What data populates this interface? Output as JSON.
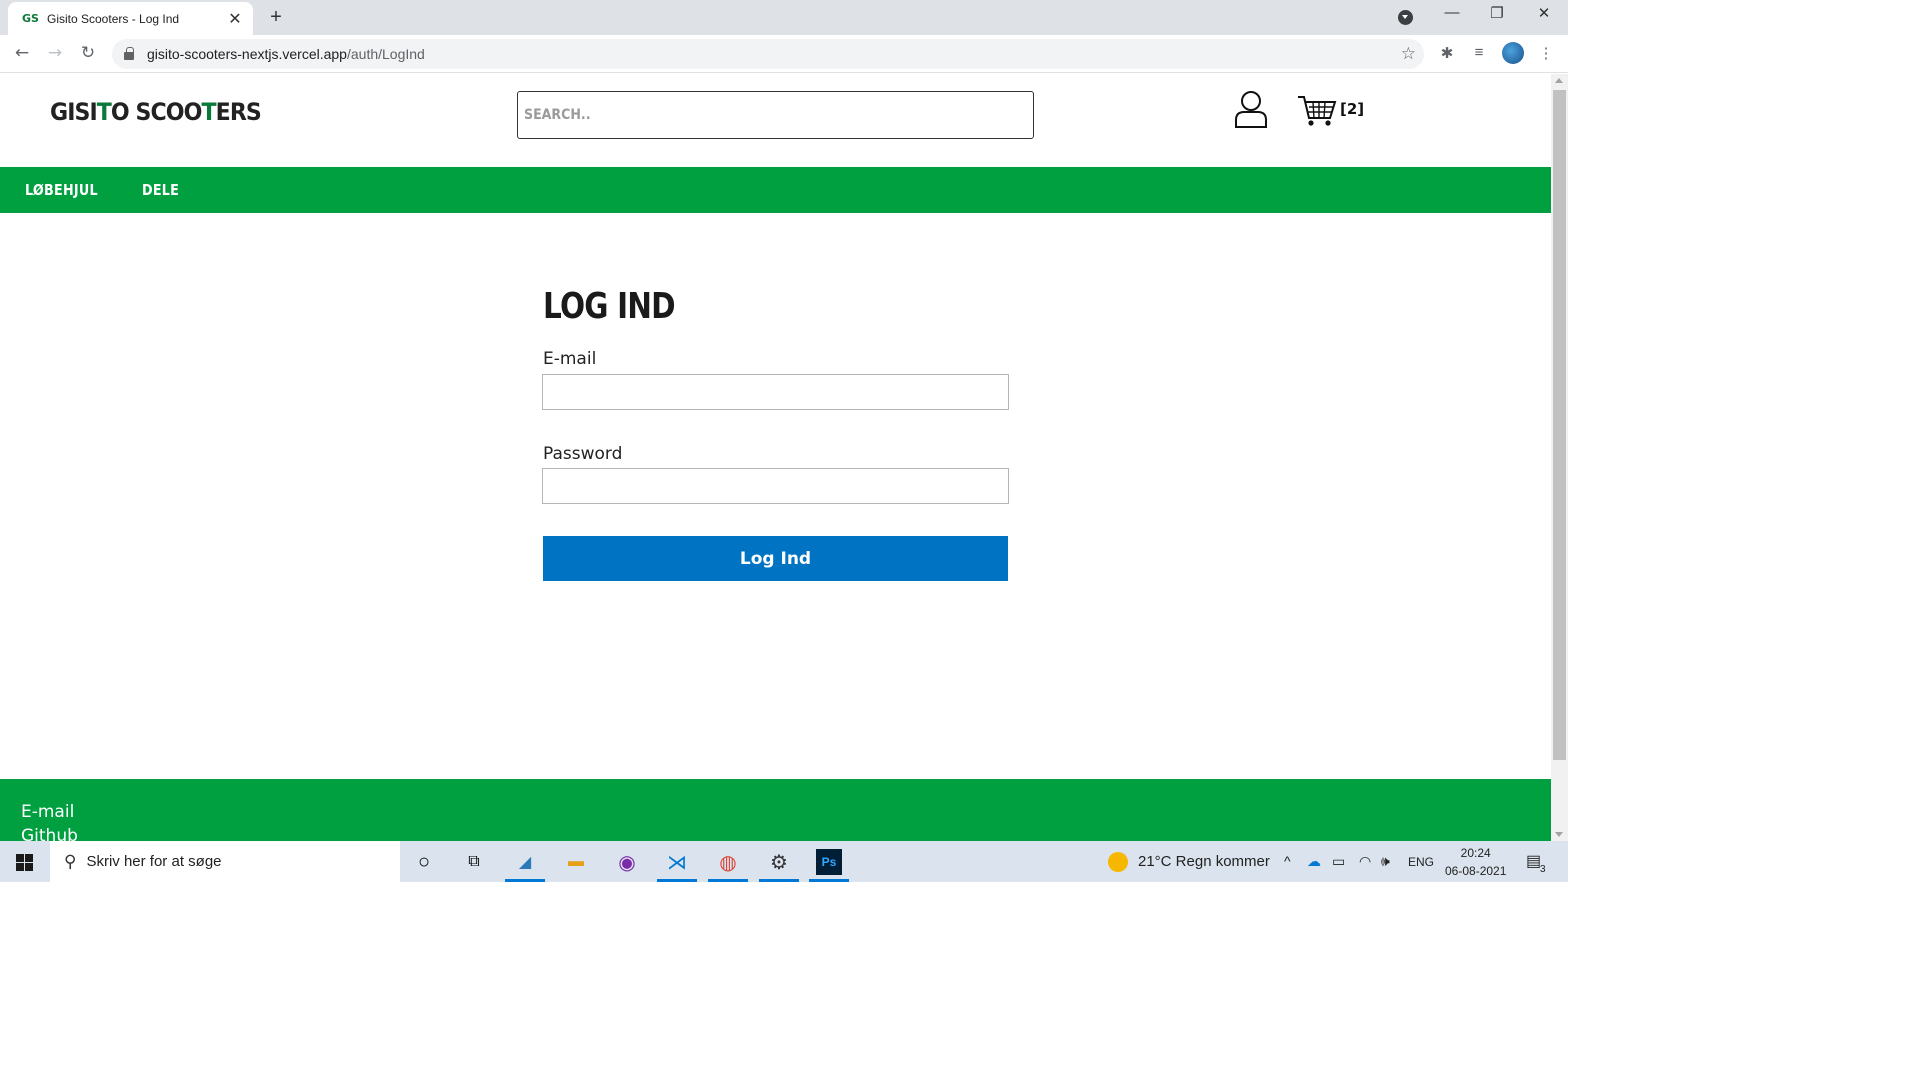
{
  "browser": {
    "tab_title": "Gisito Scooters - Log Ind",
    "favicon": "GS",
    "url_host": "gisito-scooters-nextjs.vercel.app",
    "url_path": "/auth/LogInd"
  },
  "site": {
    "logo_part1": "GISI",
    "logo_accent1": "T",
    "logo_part2": "O SCOO",
    "logo_accent2": "T",
    "logo_part3": "ERS",
    "search_placeholder": "SEARCH..",
    "cart_count": "[2]",
    "nav": [
      "LØBEHJUL",
      "DELE"
    ],
    "brand_color": "#00a040",
    "button_color": "#0074c2"
  },
  "login": {
    "title": "LOG IND",
    "email_label": "E-mail",
    "email_value": "",
    "password_label": "Password",
    "password_value": "",
    "submit_label": "Log Ind"
  },
  "footer": {
    "links": [
      "E-mail",
      "Github"
    ]
  },
  "taskbar": {
    "search_text": "Skriv her for at søge",
    "weather": "21°C  Regn kommer",
    "language": "ENG",
    "time": "20:24",
    "date": "06-08-2021",
    "notifications": "3"
  }
}
